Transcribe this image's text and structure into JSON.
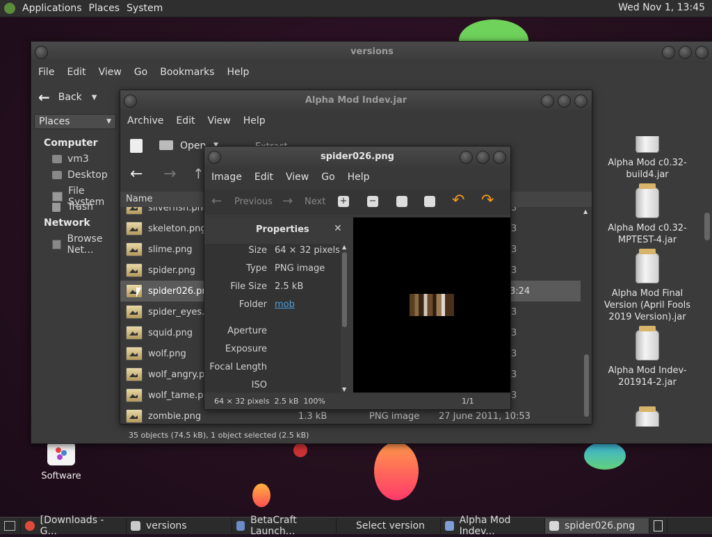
{
  "top_panel": {
    "applications": "Applications",
    "places": "Places",
    "system": "System",
    "clock": "Wed Nov 1, 13:45"
  },
  "desktop": {
    "software_label": "Software"
  },
  "nautilus": {
    "title": "versions",
    "menu": [
      "File",
      "Edit",
      "View",
      "Go",
      "Bookmarks",
      "Help"
    ],
    "back": "Back",
    "places_combo": "Places",
    "sidebar": {
      "computer_header": "Computer",
      "computer_items": [
        "vm3",
        "Desktop",
        "File System",
        "Trash"
      ],
      "network_header": "Network",
      "network_items": [
        "Browse Net..."
      ]
    },
    "status": "35 objects (74.5 kB), 1 object selected (2.5 kB)",
    "jars": [
      "Alpha Mod c0.32-build4.jar",
      "Alpha Mod c0.32-MPTEST-4.jar",
      "Alpha Mod Final Version (April Fools 2019 Version).jar",
      "Alpha Mod Indev-201914-2.jar"
    ]
  },
  "archive": {
    "title": "Alpha Mod Indev.jar",
    "menu": [
      "Archive",
      "Edit",
      "View",
      "Help"
    ],
    "open_label": "Open",
    "extract_label": "Extract",
    "col_name": "Name",
    "files": [
      {
        "name": "silverfish.png",
        "right": "3"
      },
      {
        "name": "skeleton.png",
        "right": "3"
      },
      {
        "name": "slime.png",
        "right": "3"
      },
      {
        "name": "spider.png",
        "right": "3"
      },
      {
        "name": "spider026.png",
        "right": "3:24"
      },
      {
        "name": "spider_eyes.pr",
        "right": "3"
      },
      {
        "name": "squid.png",
        "right": "3"
      },
      {
        "name": "wolf.png",
        "right": "3"
      },
      {
        "name": "wolf_angry.pr",
        "right": "3"
      },
      {
        "name": "wolf_tame.pn",
        "right": "3"
      },
      {
        "name": "zombie.png",
        "size": "1.3 kB",
        "type": "PNG image",
        "date": "27 June 2011, 10:53"
      }
    ]
  },
  "viewer": {
    "title": "spider026.png",
    "menu": [
      "Image",
      "Edit",
      "View",
      "Go",
      "Help"
    ],
    "previous": "Previous",
    "next": "Next",
    "props_title": "Properties",
    "props": [
      {
        "k": "Size",
        "v": "64 × 32 pixels"
      },
      {
        "k": "Type",
        "v": "PNG image"
      },
      {
        "k": "File Size",
        "v": "2.5 kB"
      },
      {
        "k": "Folder",
        "v": "mob"
      },
      {
        "k": "Aperture",
        "v": ""
      },
      {
        "k": "Exposure",
        "v": ""
      },
      {
        "k": "Focal Length",
        "v": ""
      },
      {
        "k": "ISO",
        "v": ""
      }
    ],
    "status_left": "64 × 32 pixels  2.5 kB  100%",
    "status_right": "1/1"
  },
  "taskbar": [
    {
      "label": "[Downloads - G...",
      "color": "#e04a3a"
    },
    {
      "label": "versions",
      "color": "#c9c9c9"
    },
    {
      "label": "BetaCraft Launch...",
      "color": "#6a8cc9"
    },
    {
      "label": "Select version",
      "color": "#888"
    },
    {
      "label": "Alpha Mod Indev...",
      "color": "#7d9ed6"
    },
    {
      "label": "spider026.png",
      "color": "#d8d8d8"
    }
  ],
  "colors": {
    "link": "#4a9fe0",
    "selection": "#5a5a5a"
  }
}
